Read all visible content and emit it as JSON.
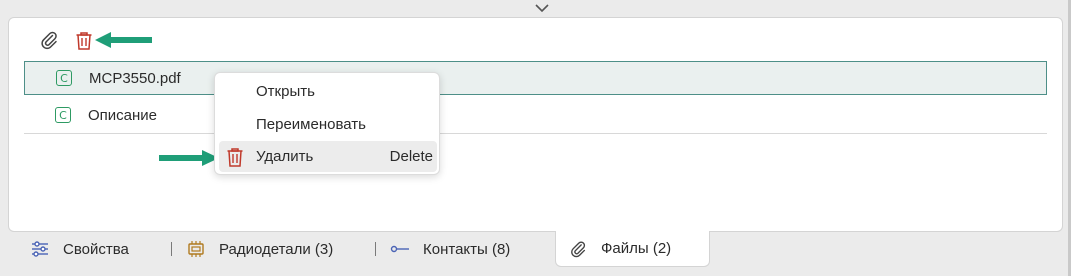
{
  "toolbar": {
    "attach_icon": "paperclip-icon",
    "delete_icon": "trash-icon",
    "delete_color": "#c0392b",
    "arrow_color": "#1f9e78"
  },
  "files": [
    {
      "badge": "C",
      "name": "MCP3550.pdf",
      "selected": true
    },
    {
      "badge": "C",
      "name": "Описание",
      "selected": false
    }
  ],
  "context_menu": {
    "items": [
      {
        "label": "Открыть",
        "shortcut": ""
      },
      {
        "label": "Переименовать",
        "shortcut": ""
      },
      {
        "label": "Удалить",
        "shortcut": "Delete",
        "icon": "trash-icon"
      }
    ]
  },
  "tabs": [
    {
      "label": "Свойства",
      "icon": "sliders-icon"
    },
    {
      "label": "Радиодетали (3)",
      "icon": "chip-icon"
    },
    {
      "label": "Контакты (8)",
      "icon": "connector-icon"
    },
    {
      "label": "Файлы (2)",
      "icon": "paperclip-icon",
      "active": true
    }
  ]
}
